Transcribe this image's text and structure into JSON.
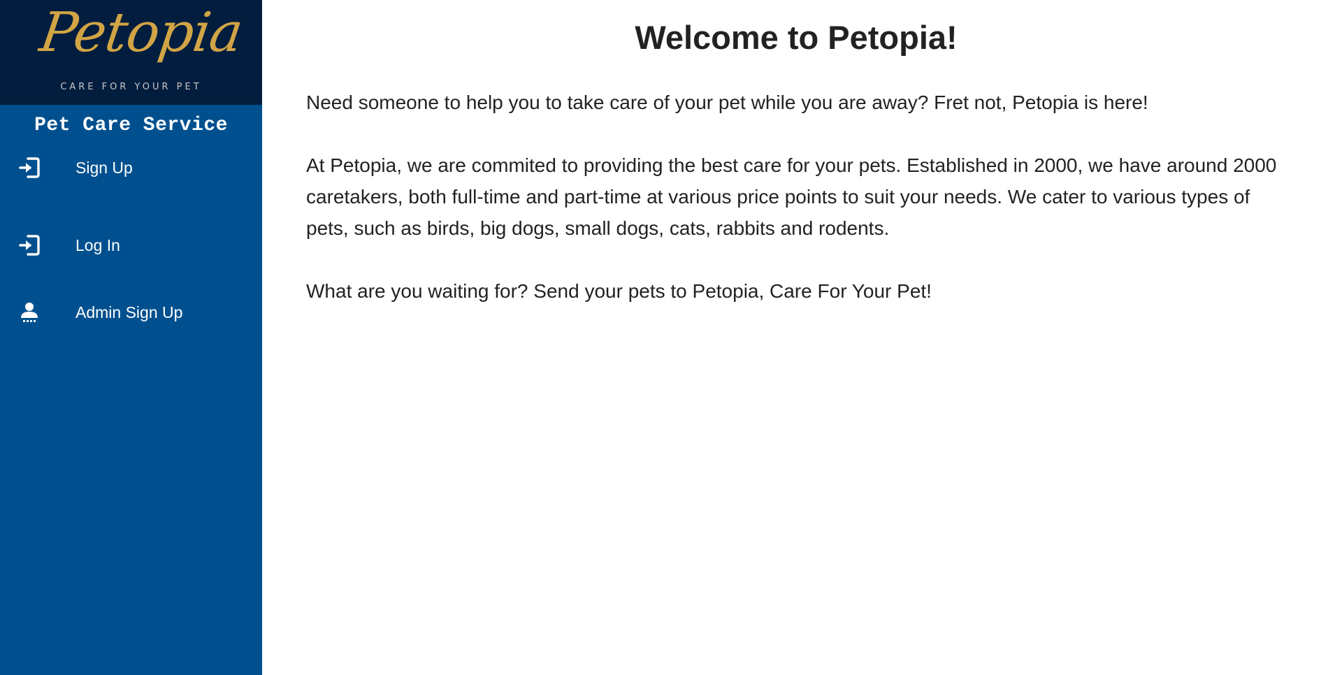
{
  "brand": {
    "logo_text": "Petopia",
    "tagline": "CARE FOR YOUR PET",
    "logo_color": "#d1a445",
    "logo_background": "#021d3e"
  },
  "sidebar": {
    "title": "Pet Care Service",
    "background": "#00508f",
    "items": [
      {
        "label": "Sign Up",
        "icon": "sign-in-icon"
      },
      {
        "label": "Log In",
        "icon": "sign-in-icon"
      },
      {
        "label": "Admin Sign Up",
        "icon": "user-icon"
      }
    ]
  },
  "main": {
    "title": "Welcome to Petopia!",
    "paragraphs": [
      "Need someone to help you to take care of your pet while you are away? Fret not, Petopia is here!",
      "At Petopia, we are commited to providing the best care for your pets. Established in 2000, we have around 2000 caretakers, both full-time and part-time at various price points to suit your needs. We cater to various types of pets, such as birds, big dogs, small dogs, cats, rabbits and rodents.",
      "What are you waiting for? Send your pets to Petopia, Care For Your Pet!"
    ]
  }
}
